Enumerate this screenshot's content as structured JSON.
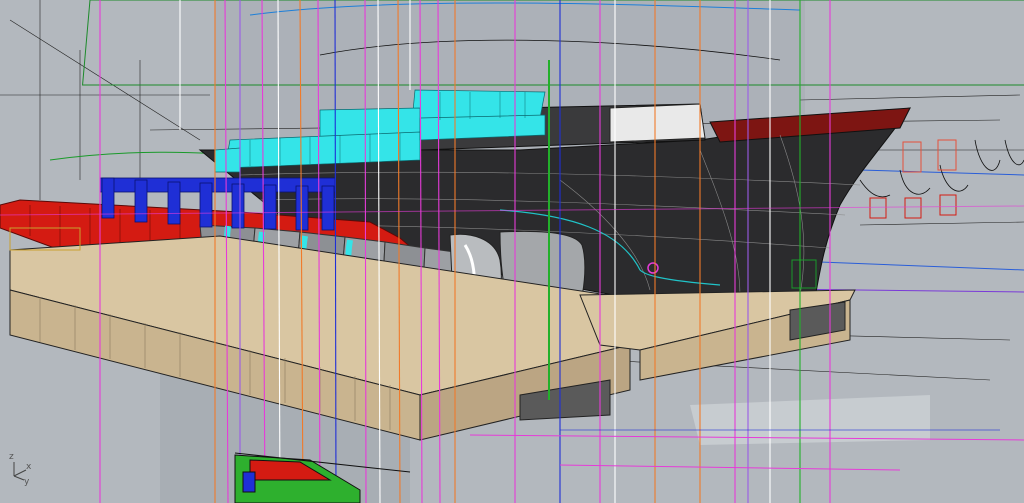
{
  "viewport": {
    "axis_indicator": {
      "x_label": "x",
      "y_label": "y",
      "z_label": "z"
    }
  },
  "colors": {
    "background": "#b7bcc2",
    "hull_dark": "#2b2b2d",
    "hull_red": "#d41b12",
    "frames_blue": "#1f2fd6",
    "superstructure_cyan": "#34e4e8",
    "cradle_tan": "#d9c6a2",
    "guide_magenta": "#e63bd8",
    "guide_orange": "#f07a2a",
    "guide_green": "#22b02a"
  }
}
